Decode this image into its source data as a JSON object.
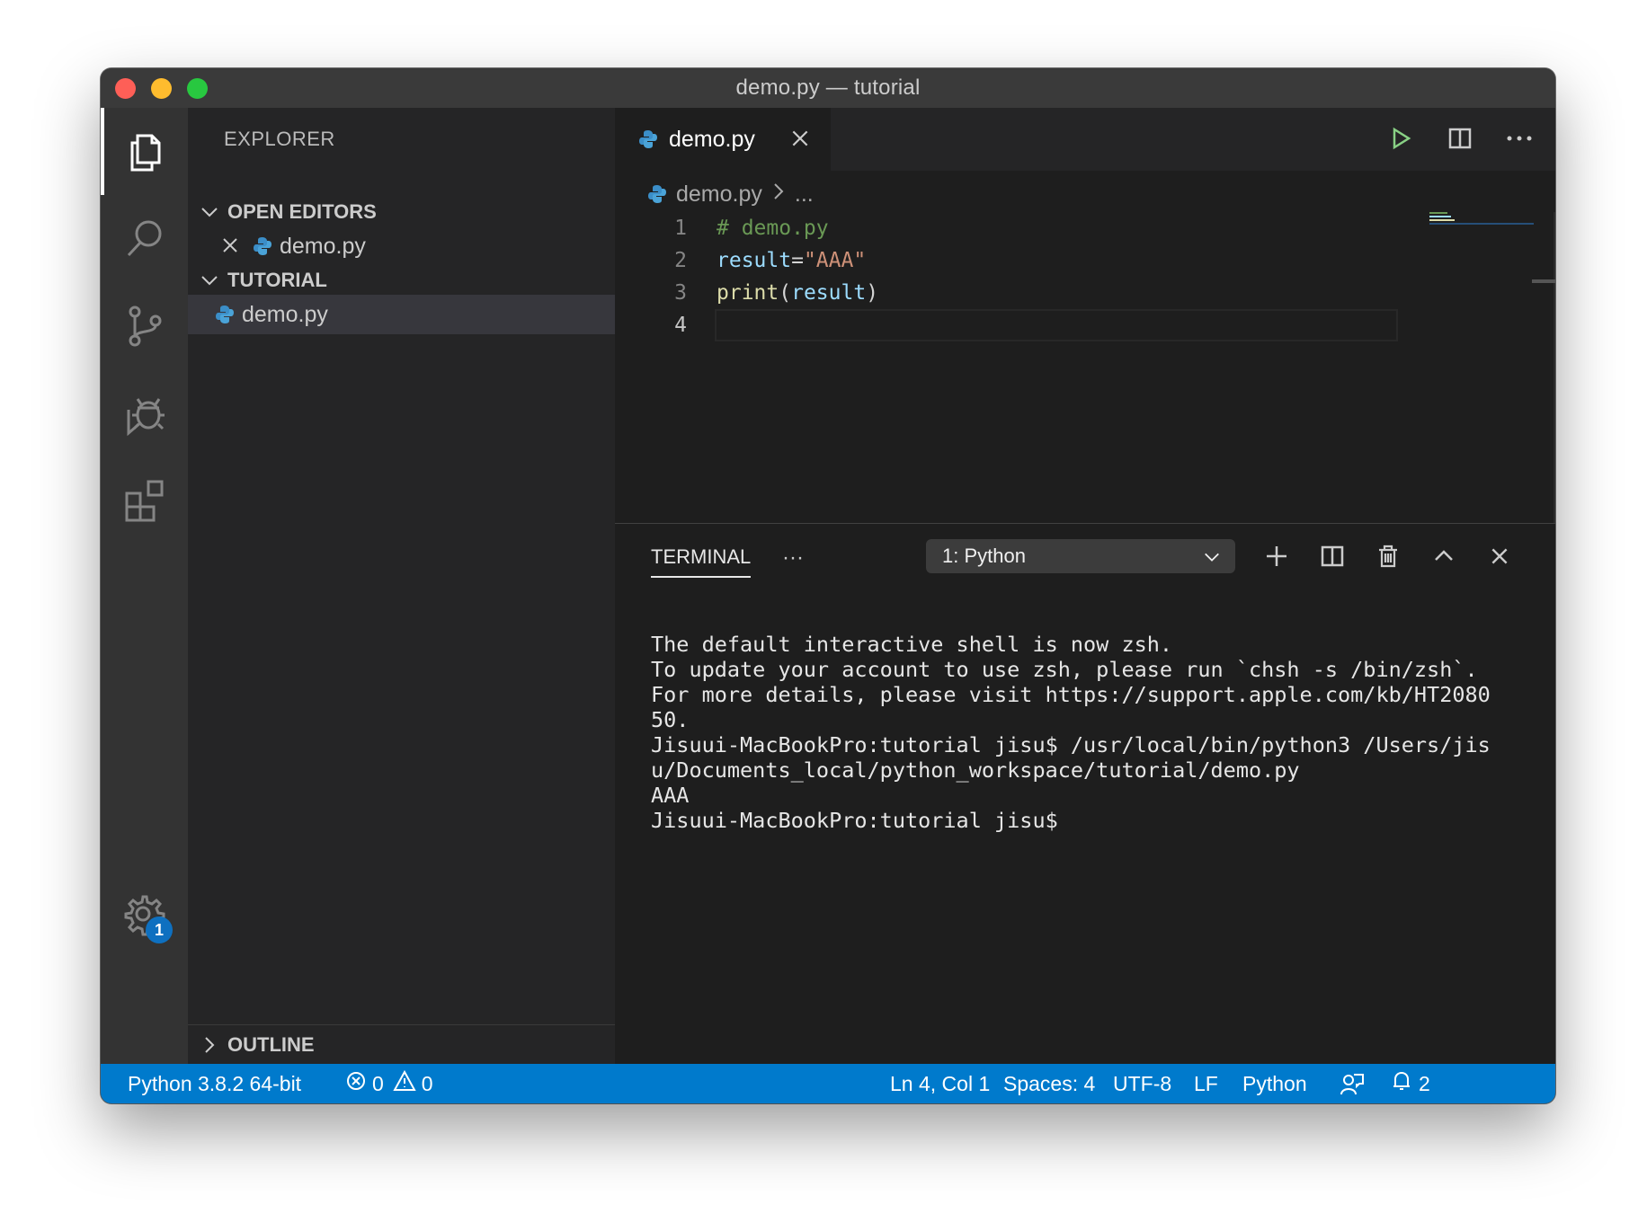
{
  "window": {
    "title": "demo.py — tutorial"
  },
  "activity_bar": {
    "items": [
      "explorer-icon",
      "search-icon",
      "source-control-icon",
      "run-debug-icon",
      "extensions-icon"
    ],
    "settings_badge": "1"
  },
  "sidebar": {
    "title": "EXPLORER",
    "open_editors": {
      "label": "OPEN EDITORS",
      "files": [
        "demo.py"
      ]
    },
    "folder": {
      "label": "TUTORIAL",
      "files": [
        "demo.py"
      ]
    },
    "outline": {
      "label": "OUTLINE"
    }
  },
  "editor": {
    "tab_label": "demo.py",
    "breadcrumb": {
      "file": "demo.py",
      "more": "..."
    },
    "lines": [
      {
        "num": "1",
        "tokens": [
          {
            "t": "# demo.py",
            "c": "comment"
          }
        ]
      },
      {
        "num": "2",
        "tokens": [
          {
            "t": "result",
            "c": "var"
          },
          {
            "t": "=",
            "c": "plain"
          },
          {
            "t": "\"AAA\"",
            "c": "str"
          }
        ]
      },
      {
        "num": "3",
        "tokens": [
          {
            "t": "print",
            "c": "fn"
          },
          {
            "t": "(",
            "c": "plain"
          },
          {
            "t": "result",
            "c": "var"
          },
          {
            "t": ")",
            "c": "plain"
          }
        ]
      },
      {
        "num": "4",
        "tokens": []
      }
    ]
  },
  "panel": {
    "tab": "TERMINAL",
    "more": "···",
    "terminal_select": "1: Python",
    "terminal_lines": [
      "The default interactive shell is now zsh.",
      "To update your account to use zsh, please run `chsh -s /bin/zsh`.",
      "For more details, please visit https://support.apple.com/kb/HT2080",
      "50.",
      "Jisuui-MacBookPro:tutorial jisu$ /usr/local/bin/python3 /Users/jis",
      "u/Documents_local/python_workspace/tutorial/demo.py",
      "AAA",
      "Jisuui-MacBookPro:tutorial jisu$"
    ]
  },
  "statusbar": {
    "interpreter": "Python 3.8.2 64-bit",
    "errors": "0",
    "warnings": "0",
    "cursor": "Ln 4, Col 1",
    "spaces": "Spaces: 4",
    "encoding": "UTF-8",
    "eol": "LF",
    "language": "Python",
    "notifications": "2"
  },
  "colors": {
    "accent": "#007acc",
    "comment": "#6a9955",
    "string": "#ce9178",
    "function": "#dcdcaa",
    "variable": "#9cdcfe"
  }
}
